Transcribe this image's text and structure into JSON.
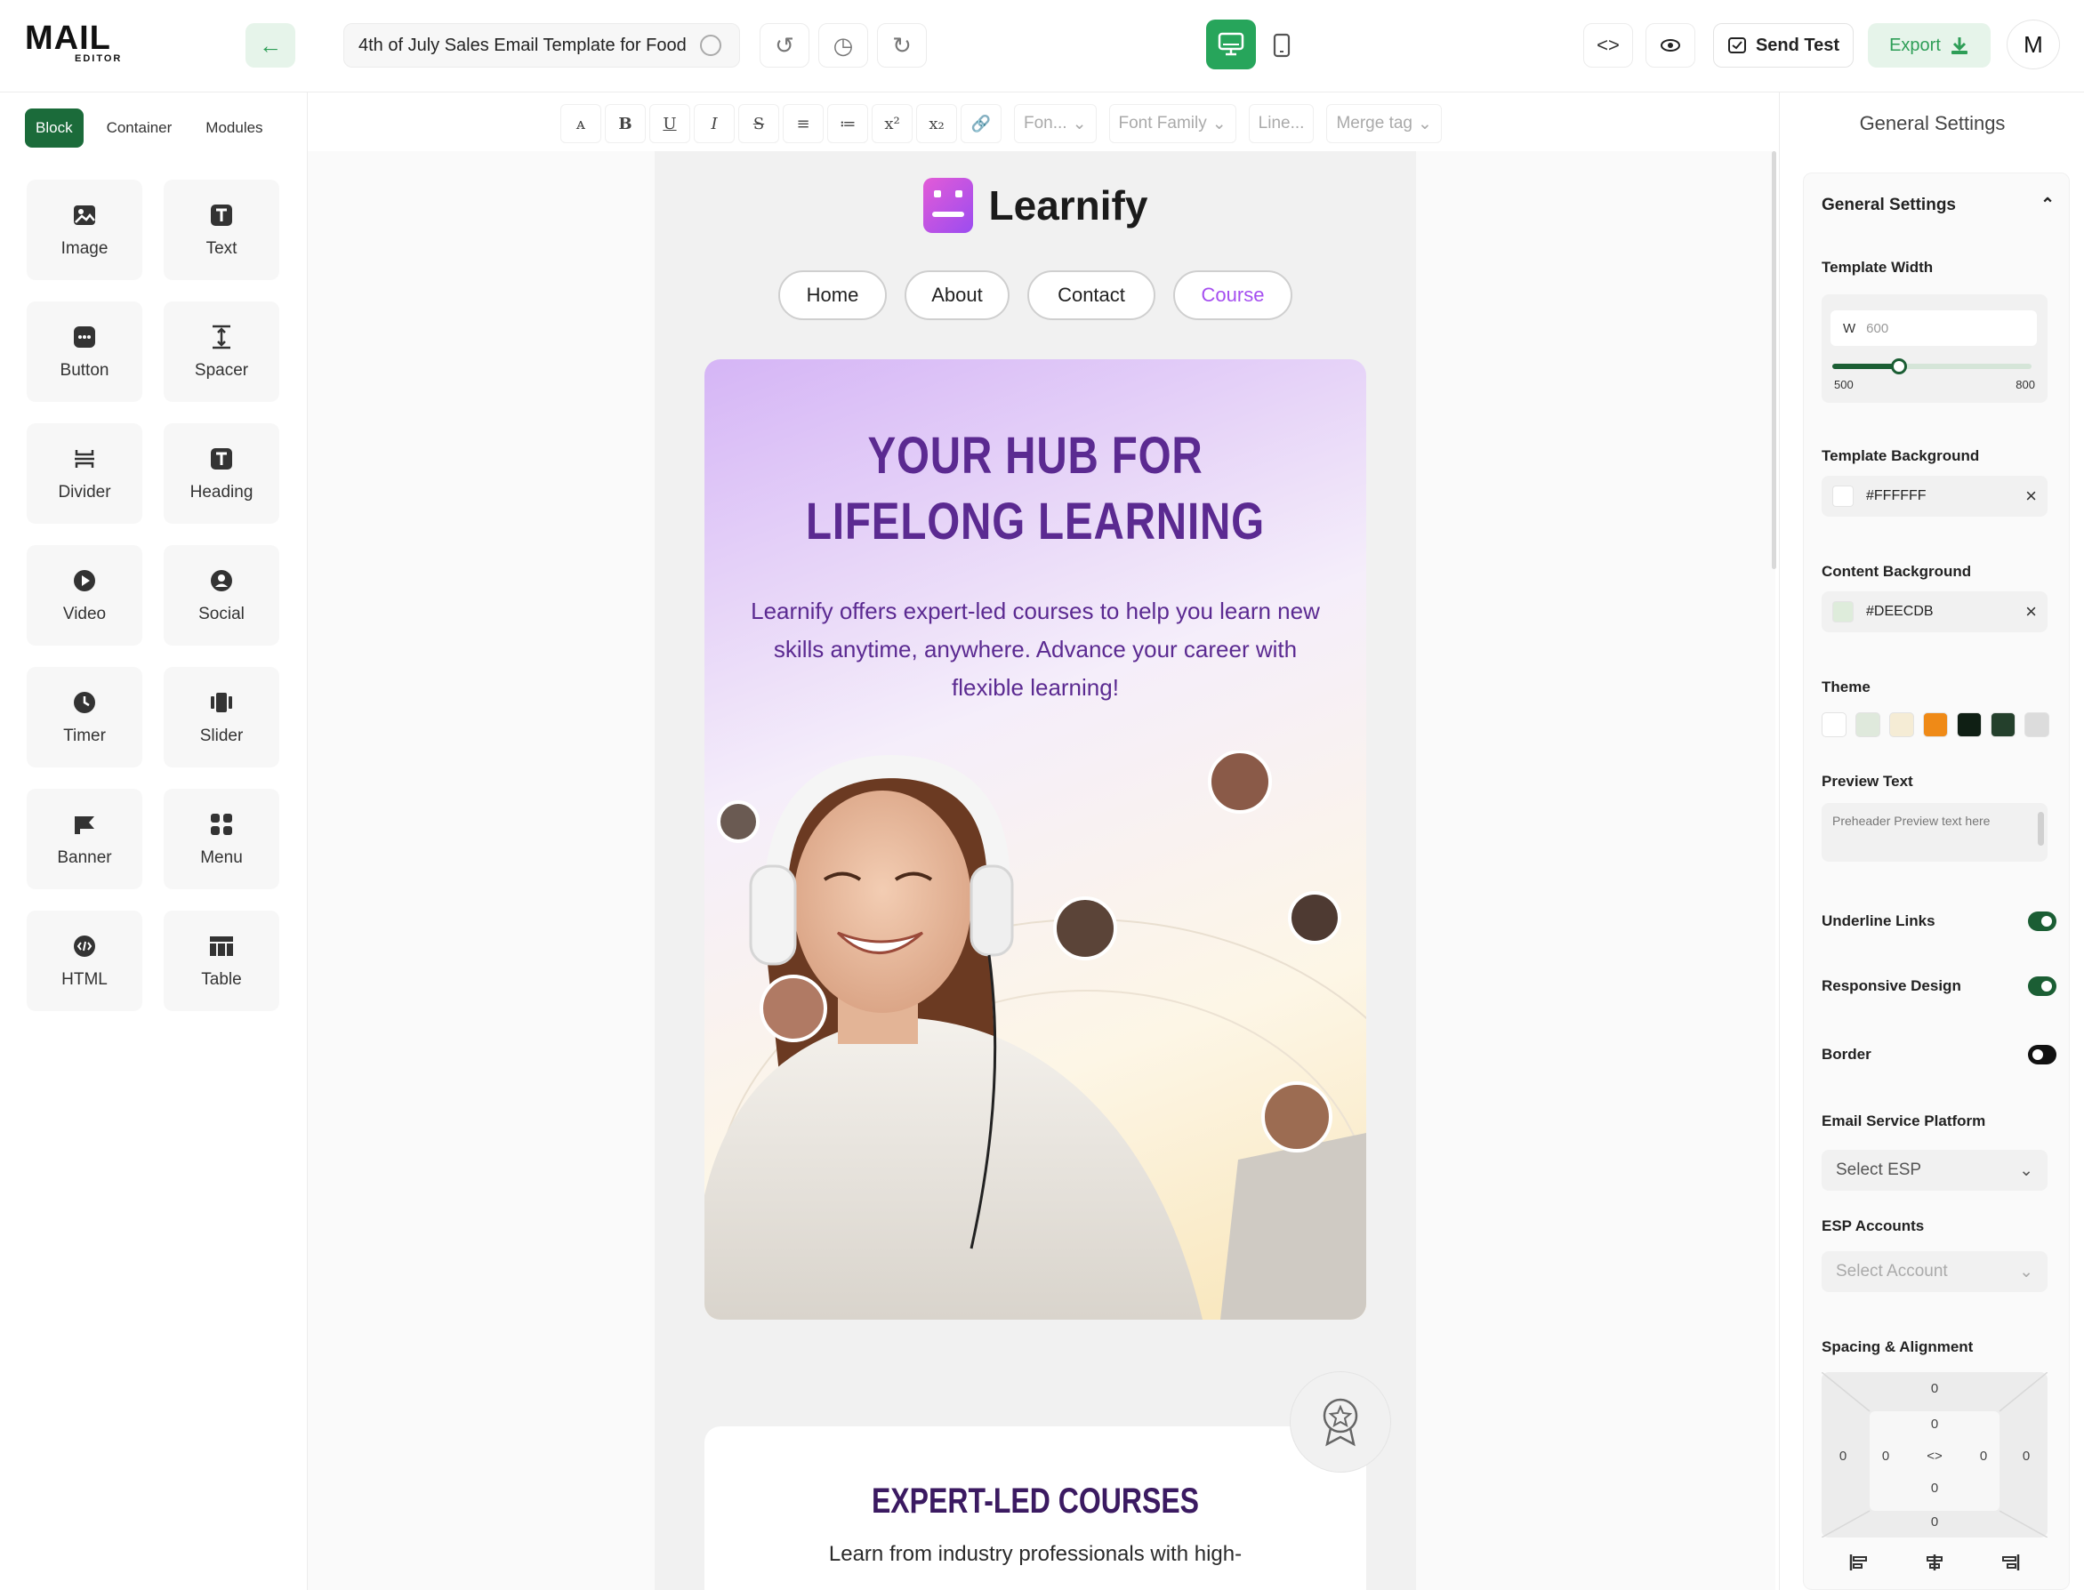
{
  "app": {
    "logo_main": "MAIL",
    "logo_sub": "EDITOR",
    "doc_title": "4th of July Sales Email Template for Food",
    "send_test_label": "Send Test",
    "export_label": "Export",
    "avatar_initial": "M"
  },
  "left": {
    "tabs": [
      "Block",
      "Container",
      "Modules"
    ],
    "blocks": [
      {
        "label": "Image",
        "icon": "image-icon"
      },
      {
        "label": "Text",
        "icon": "text-icon"
      },
      {
        "label": "Button",
        "icon": "button-icon"
      },
      {
        "label": "Spacer",
        "icon": "spacer-icon"
      },
      {
        "label": "Divider",
        "icon": "divider-icon"
      },
      {
        "label": "Heading",
        "icon": "heading-icon"
      },
      {
        "label": "Video",
        "icon": "video-icon"
      },
      {
        "label": "Social",
        "icon": "social-icon"
      },
      {
        "label": "Timer",
        "icon": "timer-icon"
      },
      {
        "label": "Slider",
        "icon": "slider-icon"
      },
      {
        "label": "Banner",
        "icon": "banner-icon"
      },
      {
        "label": "Menu",
        "icon": "menu-icon"
      },
      {
        "label": "HTML",
        "icon": "html-icon"
      },
      {
        "label": "Table",
        "icon": "table-icon"
      }
    ]
  },
  "toolbar": {
    "font_size": "Fon...",
    "font_family": "Font Family",
    "line_height": "Line...",
    "merge_tag": "Merge tag"
  },
  "email": {
    "brand": "Learnify",
    "nav": [
      "Home",
      "About",
      "Contact",
      "Course"
    ],
    "hero_title_1": "YOUR HUB FOR",
    "hero_title_2": "LIFELONG LEARNING",
    "hero_text": "Learnify offers expert-led courses to help you learn new skills anytime, anywhere. Advance your career with flexible learning!",
    "feature_title": "EXPERT-LED COURSES",
    "feature_text": "Learn from industry professionals with high-"
  },
  "right": {
    "header": "General Settings",
    "section_title": "General Settings",
    "template_width_label": "Template Width",
    "width_prefix": "W",
    "width_value": "600",
    "width_min": "500",
    "width_max": "800",
    "template_bg_label": "Template Background",
    "template_bg": "#FFFFFF",
    "content_bg_label": "Content Background",
    "content_bg": "#DEECDB",
    "theme_label": "Theme",
    "theme_colors": [
      "#ffffff",
      "#dfe9dc",
      "#f5ecd5",
      "#ef8a17",
      "#0f1f14",
      "#24402c",
      "#dcdcdc"
    ],
    "preview_text_label": "Preview Text",
    "preview_placeholder": "Preheader Preview text here",
    "underline_links_label": "Underline Links",
    "underline_links": true,
    "responsive_label": "Responsive Design",
    "responsive": true,
    "border_label": "Border",
    "border": false,
    "esp_label": "Email Service Platform",
    "esp_placeholder": "Select ESP",
    "accounts_label": "ESP Accounts",
    "accounts_placeholder": "Select Account",
    "spacing_label": "Spacing & Alignment",
    "margin": {
      "top": "0",
      "right": "0",
      "bottom": "0",
      "left": "0"
    },
    "padding": {
      "top": "0",
      "right": "0",
      "bottom": "0",
      "left": "0"
    }
  },
  "colors": {
    "accent": "#27a55b",
    "dark_green": "#1b6b3a",
    "hero_purple": "#5b2a91",
    "course_link": "#a54ef0"
  }
}
